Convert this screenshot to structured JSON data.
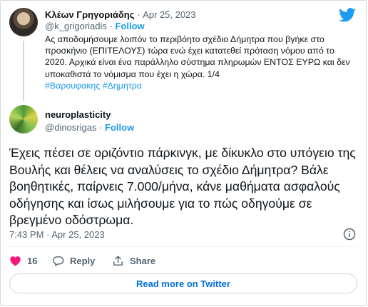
{
  "parent_tweet": {
    "author_name": "Κλέων Γρηγοριάδης",
    "dot": "·",
    "date": "Apr 25, 2023",
    "handle": "@k_grigoriadis",
    "follow_label": "Follow",
    "text": "Ας αποδομήσουμε λοιπόν το περιβόητο σχέδιο Δήμητρα που βγήκε στο προσκήνιο (ΕΠΙΤΕΛΟΥΣ) τώρα ενώ έχει κατατεθεί πρόταση νόμου από το 2020. Αρχικά είναι ένα παράλληλο σύστημα πληρωμών ΕΝΤΟΣ ΕΥΡΩ και δεν υποκαθιστά το νόμισμα που έχει η χώρα. 1/4",
    "hashtags": [
      "#Βαρουφακης",
      "#Δημητρα"
    ]
  },
  "main_tweet": {
    "author_name": "neuroplasticity",
    "handle": "@dinosrigas",
    "follow_label": "Follow",
    "text": "Έχεις πέσει σε οριζόντιο πάρκινγκ, με δίκυκλο στο υπόγειο της Βουλής και θέλεις να αναλύσεις το σχέδιο Δήμητρα? Βάλε βοηθητικές, παίρνεις 7.000/μήνα, κάνε μαθήματα ασφαλούς οδήγησης και ίσως μιλήσουμε για το πώς οδηγούμε σε βρεγμένο οδόστρωμα.",
    "timestamp": "7:43 PM · Apr 25, 2023",
    "likes": "16",
    "reply_label": "Reply",
    "share_label": "Share",
    "read_more_label": "Read more on Twitter"
  },
  "colors": {
    "accent": "#1d9bf0",
    "like_red": "#f91880",
    "secondary_text": "#536471"
  },
  "icons": [
    "twitter-logo-icon",
    "info-icon",
    "heart-icon",
    "reply-icon",
    "share-icon"
  ]
}
